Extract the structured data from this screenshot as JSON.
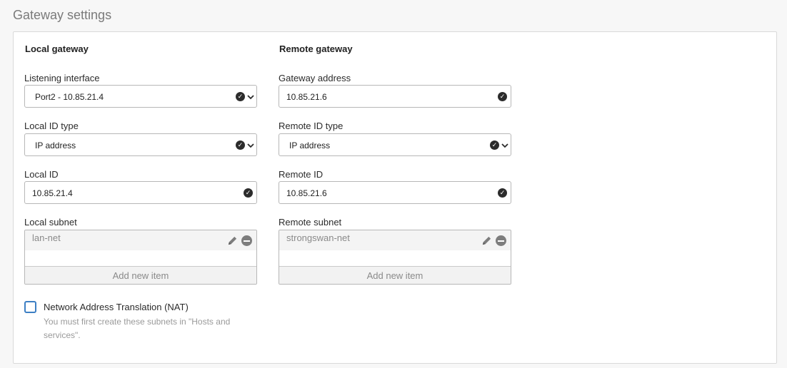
{
  "section": {
    "title": "Gateway settings"
  },
  "local": {
    "heading": "Local gateway",
    "listening_interface": {
      "label": "Listening interface",
      "value": "Port2 - 10.85.21.4"
    },
    "id_type": {
      "label": "Local ID type",
      "value": "IP address"
    },
    "id": {
      "label": "Local ID",
      "value": "10.85.21.4"
    },
    "subnet": {
      "label": "Local subnet",
      "items": [
        "lan-net"
      ],
      "add_label": "Add new item"
    }
  },
  "remote": {
    "heading": "Remote gateway",
    "gateway_address": {
      "label": "Gateway address",
      "value": "10.85.21.6"
    },
    "id_type": {
      "label": "Remote ID type",
      "value": "IP address"
    },
    "id": {
      "label": "Remote ID",
      "value": "10.85.21.6"
    },
    "subnet": {
      "label": "Remote subnet",
      "items": [
        "strongswan-net"
      ],
      "add_label": "Add new item"
    }
  },
  "nat": {
    "label": "Network Address Translation (NAT)",
    "checked": false,
    "help": "You must first create these subnets in \"Hosts and services\"."
  },
  "icons": {
    "valid": "check-circle-icon",
    "dropdown": "chevron-down-icon",
    "edit": "pencil-icon",
    "remove": "minus-circle-icon"
  },
  "colors": {
    "checkbox_accent": "#3d7fc4",
    "valid_icon": "#2c2c2c"
  }
}
